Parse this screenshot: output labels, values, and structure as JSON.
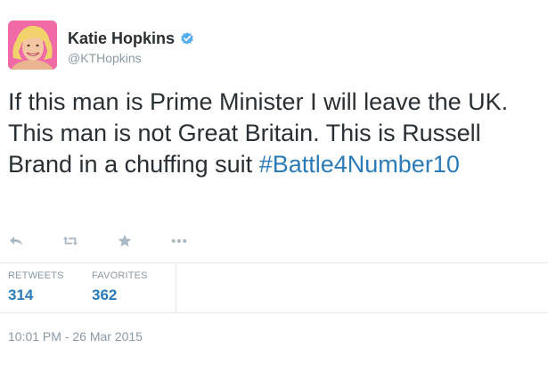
{
  "author": {
    "display_name": "Katie Hopkins",
    "handle": "@KTHopkins",
    "verified": true,
    "avatar_icon": "profile-photo"
  },
  "tweet": {
    "text": "If this man is Prime Minister I will leave the UK. This man is not Great Britain. This is Russell Brand in a chuffing suit",
    "hashtag": "#Battle4Number10"
  },
  "actions": [
    {
      "name": "reply",
      "icon": "reply-icon"
    },
    {
      "name": "retweet",
      "icon": "retweet-icon"
    },
    {
      "name": "favorite",
      "icon": "star-icon"
    },
    {
      "name": "more",
      "icon": "more-icon"
    }
  ],
  "stats": {
    "retweets_label": "RETWEETS",
    "retweets_value": "314",
    "favorites_label": "FAVORITES",
    "favorites_value": "362"
  },
  "timestamp": "10:01 PM - 26 Mar 2015",
  "colors": {
    "link": "#2b7bb9",
    "muted": "#8899a6",
    "text": "#292f33",
    "divider": "#e1e8ed",
    "verified": "#55acee"
  }
}
